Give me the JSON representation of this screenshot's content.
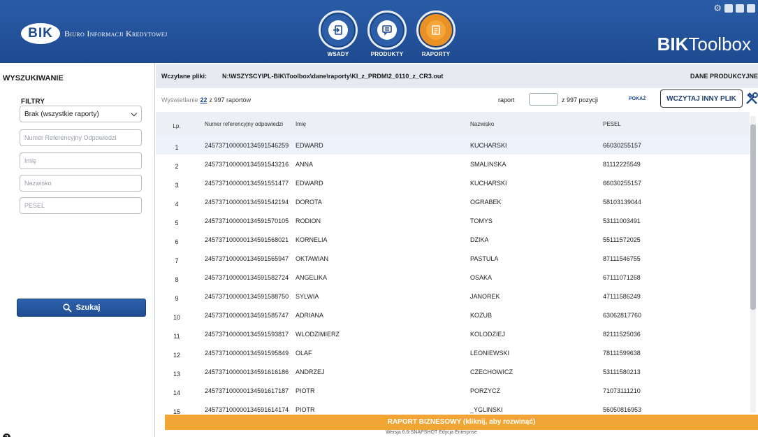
{
  "header": {
    "logo_mark": "BIK",
    "logo_text": "Biuro Informacji Kredytowej",
    "brand_bold": "BIK",
    "brand_light": "Toolbox",
    "nav": [
      {
        "label": "WSADY"
      },
      {
        "label": "PRODUKTY"
      },
      {
        "label": "RAPORTY"
      }
    ]
  },
  "sidebar": {
    "title": "WYSZUKIWANIE",
    "filters_label": "FILTRY",
    "select_value": "Brak (wszystkie raporty)",
    "placeholders": {
      "ref": "Numer Referencyjny Odpowiedzi",
      "imie": "Imię",
      "nazwisko": "Nazwisko",
      "pesel": "PESEL"
    },
    "search_label": "Szukaj"
  },
  "filebar": {
    "label": "Wczytane pliki:",
    "path": "N:\\WSZYSCY\\PL-BIK\\Toolbox\\dane\\raporty\\KI_z_PRDM\\2_0110_z_CR3.out",
    "env": "DANE PRODUKCYJNE"
  },
  "toolbar": {
    "shown_prefix": "Wyświetlanie",
    "shown_count": "22",
    "shown_suffix": "z 997 raportów",
    "raport_label": "raport",
    "of_label": "z 997 pozycji",
    "show_label": "POKAŻ",
    "load_label": "WCZYTAJ INNY PLIK"
  },
  "table": {
    "headers": {
      "lp": "Lp.",
      "ref": "Numer referencyjny odpowiedzi",
      "imie": "Imię",
      "nazwisko": "Nazwisko",
      "pesel": "PESEL"
    },
    "rows": [
      {
        "lp": "1",
        "ref": "245737100000134591546259",
        "imie": "EDWARD",
        "nazwisko": "KUCHARSKI",
        "pesel": "66030255157"
      },
      {
        "lp": "2",
        "ref": "245737100000134591543216",
        "imie": "ANNA",
        "nazwisko": "SMALINSKA",
        "pesel": "81112225549"
      },
      {
        "lp": "3",
        "ref": "245737100000134591551477",
        "imie": "EDWARD",
        "nazwisko": "KUCHARSKI",
        "pesel": "66030255157"
      },
      {
        "lp": "4",
        "ref": "245737100000134591542194",
        "imie": "DOROTA",
        "nazwisko": "OGRABEK",
        "pesel": "58103139044"
      },
      {
        "lp": "5",
        "ref": "245737100000134591570105",
        "imie": "RODION",
        "nazwisko": "TOMYS",
        "pesel": "53111003491"
      },
      {
        "lp": "6",
        "ref": "245737100000134591568021",
        "imie": "KORNELIA",
        "nazwisko": "DZIKA",
        "pesel": "55111572025"
      },
      {
        "lp": "7",
        "ref": "245737100000134591565947",
        "imie": "OKTAWIAN",
        "nazwisko": "PASTULA",
        "pesel": "87111546755"
      },
      {
        "lp": "8",
        "ref": "245737100000134591582724",
        "imie": "ANGELIKA",
        "nazwisko": "OSAKA",
        "pesel": "67111071268"
      },
      {
        "lp": "9",
        "ref": "245737100000134591588750",
        "imie": "SYLWIA",
        "nazwisko": "JANOREK",
        "pesel": "47111586249"
      },
      {
        "lp": "10",
        "ref": "245737100000134591585747",
        "imie": "ADRIANA",
        "nazwisko": "KOZUB",
        "pesel": "63062817760"
      },
      {
        "lp": "11",
        "ref": "245737100000134591593817",
        "imie": "WLODZIMIERZ",
        "nazwisko": "KOLODZIEJ",
        "pesel": "82111525036"
      },
      {
        "lp": "12",
        "ref": "245737100000134591595849",
        "imie": "OLAF",
        "nazwisko": "LEONIEWSKI",
        "pesel": "78111599638"
      },
      {
        "lp": "13",
        "ref": "245737100000134591616186",
        "imie": "ANDRZEJ",
        "nazwisko": "CZECHOWICZ",
        "pesel": "53111580213"
      },
      {
        "lp": "14",
        "ref": "245737100000134591617187",
        "imie": "PIOTR",
        "nazwisko": "PORZYCZ",
        "pesel": "71073111210"
      },
      {
        "lp": "15",
        "ref": "245737100000134591614174",
        "imie": "PIOTR",
        "nazwisko": "_YGLINSKI",
        "pesel": "56050816953"
      }
    ]
  },
  "business_bar": "RAPORT BIZNESOWY (kliknij, aby rozwinąć)",
  "version": "Wersja 6.6-SNAPSHOT Edycja Enterprise",
  "colors": {
    "header": "#1e4a90",
    "accent": "#f2a535",
    "active_nav": "#e99124"
  }
}
